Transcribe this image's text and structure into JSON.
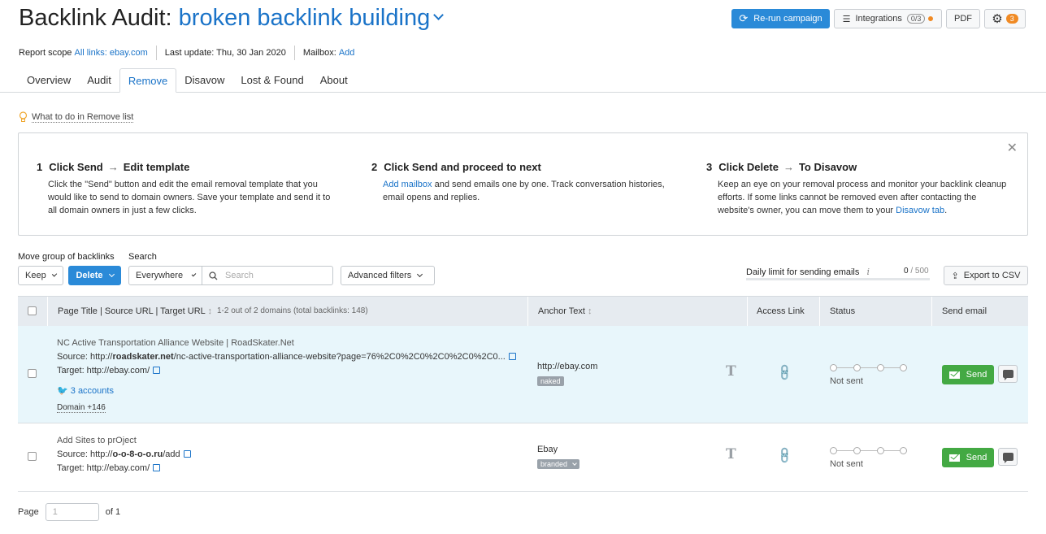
{
  "header": {
    "title_prefix": "Backlink Audit:",
    "campaign": "broken backlink building",
    "rerun_label": "Re-run campaign",
    "integrations_label": "Integrations",
    "integrations_count": "0/3",
    "pdf_label": "PDF",
    "settings_badge": "3"
  },
  "scope": {
    "label": "Report scope",
    "value": "All links: ebay.com",
    "last_update": "Last update: Thu, 30 Jan 2020",
    "mailbox_label": "Mailbox:",
    "mailbox_action": "Add"
  },
  "tabs": [
    {
      "label": "Overview"
    },
    {
      "label": "Audit"
    },
    {
      "label": "Remove"
    },
    {
      "label": "Disavow"
    },
    {
      "label": "Lost & Found"
    },
    {
      "label": "About"
    }
  ],
  "tip": "What to do in Remove list",
  "steps": [
    {
      "num": "1",
      "head_a": "Click Send",
      "head_b": "Edit template",
      "body": "Click the \"Send\" button and edit the email removal template that you would like to send to domain owners. Save your template and send it to all domain owners in just a few clicks."
    },
    {
      "num": "2",
      "head_a": "Click Send and proceed to next",
      "head_b": "",
      "body_link": "Add mailbox",
      "body": " and send emails one by one. Track conversation histories, email opens and replies."
    },
    {
      "num": "3",
      "head_a": "Click Delete",
      "head_b": "To Disavow",
      "body": "Keep an eye on your removal process and monitor your backlink cleanup efforts. If some links cannot be removed even after contacting the website's owner, you can move them to your ",
      "body_link": "Disavow tab",
      "body_end": "."
    }
  ],
  "filters": {
    "move_group_label": "Move group of backlinks",
    "search_label": "Search",
    "keep_label": "Keep",
    "delete_label": "Delete",
    "everywhere_label": "Everywhere",
    "search_placeholder": "Search",
    "advanced_label": "Advanced filters",
    "daily_limit_label": "Daily limit for sending emails",
    "daily_limit_value": "0",
    "daily_limit_max": "/ 500",
    "export_label": "Export to CSV"
  },
  "table": {
    "headers": {
      "page": "Page Title | Source URL | Target URL",
      "count": "1-2 out of 2 domains (total backlinks: 148)",
      "anchor": "Anchor Text",
      "access": "Access Link",
      "status": "Status",
      "send": "Send email"
    },
    "rows": [
      {
        "title": "NC Active Transportation Alliance Website | RoadSkater.Net",
        "source_prefix": "Source: http://",
        "source_domain": "roadskater.net",
        "source_path": "/nc-active-transportation-alliance-website?page=76%2C0%2C0%2C0%2C0%2C0...",
        "target": "Target: http://ebay.com/",
        "twitter": "3 accounts",
        "domain_more": "Domain +146",
        "anchor": "http://ebay.com",
        "anchor_tag": "naked",
        "status": "Not sent",
        "send_label": "Send"
      },
      {
        "title": "Add Sites to prOject",
        "source_prefix": "Source: http://",
        "source_domain": "o-o-8-o-o.ru",
        "source_path": "/add",
        "target": "Target: http://ebay.com/",
        "anchor": "Ebay",
        "anchor_tag": "branded",
        "status": "Not sent",
        "send_label": "Send"
      }
    ]
  },
  "pager": {
    "label": "Page",
    "placeholder": "1",
    "of_label": "of",
    "total": "1"
  }
}
